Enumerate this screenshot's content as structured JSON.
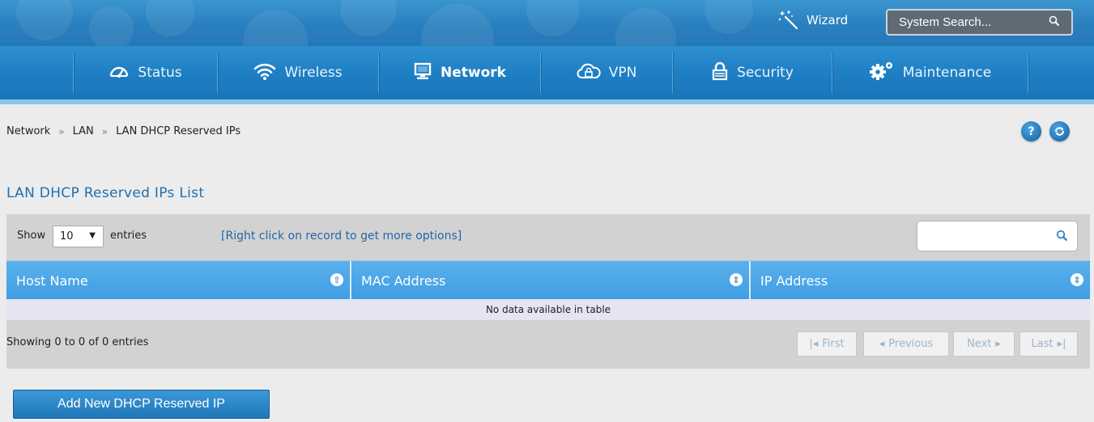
{
  "header": {
    "wizard_label": "Wizard",
    "search_placeholder": "System Search..."
  },
  "nav": {
    "items": [
      {
        "label": "Status",
        "icon": "dashboard-gauge-icon"
      },
      {
        "label": "Wireless",
        "icon": "wifi-icon"
      },
      {
        "label": "Network",
        "icon": "monitor-icon"
      },
      {
        "label": "VPN",
        "icon": "cloud-lock-icon"
      },
      {
        "label": "Security",
        "icon": "padlock-icon"
      },
      {
        "label": "Maintenance",
        "icon": "gears-icon"
      }
    ],
    "active": "Network"
  },
  "breadcrumb": {
    "items": [
      "Network",
      "LAN",
      "LAN DHCP Reserved IPs"
    ],
    "separator": "»"
  },
  "page": {
    "title": "LAN DHCP Reserved IPs List"
  },
  "table_controls": {
    "show_label": "Show",
    "entries_value": "10",
    "entries_label": "entries",
    "hint": "[Right click on record to get more options]"
  },
  "table": {
    "columns": [
      "Host Name",
      "MAC Address",
      "IP Address"
    ],
    "empty_message": "No data available in table"
  },
  "pagination": {
    "info": "Showing 0 to 0 of 0 entries",
    "first": "First",
    "previous": "Previous",
    "next": "Next",
    "last": "Last"
  },
  "actions": {
    "add_label": "Add New DHCP Reserved IP"
  },
  "colors": {
    "primary_blue": "#1f7fc4",
    "header_blue": "#4aa6e6",
    "link_blue": "#2266a8"
  }
}
